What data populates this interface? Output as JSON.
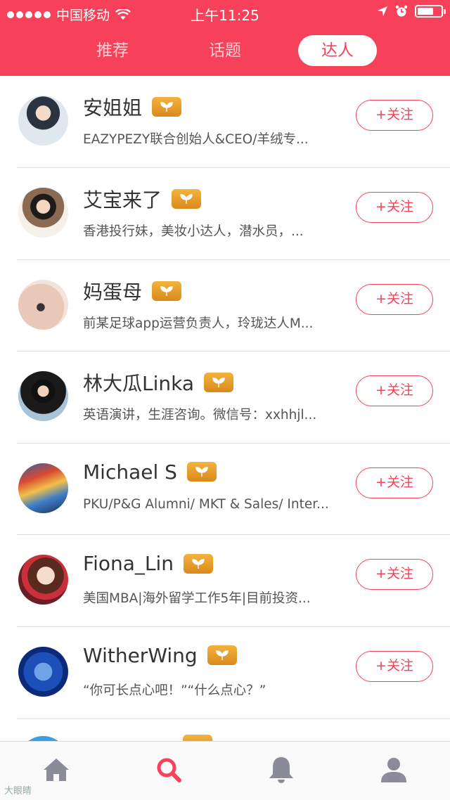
{
  "status_bar": {
    "carrier": "中国移动",
    "time": "上午11:25"
  },
  "tabs": [
    {
      "label": "推荐",
      "active": false
    },
    {
      "label": "话题",
      "active": false
    },
    {
      "label": "达人",
      "active": true
    }
  ],
  "follow_label": "+关注",
  "users": [
    {
      "name": "安姐姐",
      "desc": "EAZYPEZY联合创始人&CEO/羊绒专..."
    },
    {
      "name": "艾宝来了",
      "desc": "香港投行妹，美妆小达人，潜水员，..."
    },
    {
      "name": "妈蛋母",
      "desc": "前某足球app运营负责人，玲珑达人M..."
    },
    {
      "name": "林大瓜Linka",
      "desc": "英语演讲，生涯咨询。微信号：xxhhjl..."
    },
    {
      "name": "Michael S",
      "desc": "PKU/P&G Alumni/ MKT & Sales/ Inter..."
    },
    {
      "name": "Fiona_Lin",
      "desc": "美国MBA|海外留学工作5年|目前投资..."
    },
    {
      "name": "WitherWing",
      "desc": "“你可长点心吧！”“什么点心？”"
    }
  ],
  "colors": {
    "accent": "#f7415a",
    "badge": "#e89e2a"
  },
  "tab_bar": [
    {
      "icon": "home-icon",
      "active": false
    },
    {
      "icon": "search-icon",
      "active": true
    },
    {
      "icon": "bell-icon",
      "active": false
    },
    {
      "icon": "profile-icon",
      "active": false
    }
  ],
  "watermark": "大眼睛"
}
